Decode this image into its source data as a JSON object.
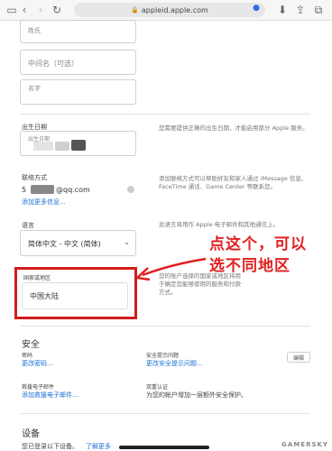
{
  "browser": {
    "url": "appleid.apple.com"
  },
  "form": {
    "last_name_placeholder": "姓氏",
    "middle_name_placeholder": "中间名（可选）",
    "first_name_placeholder": "名字",
    "birthday_label": "出生日期",
    "birthday_placeholder": "出生日期",
    "birthday_desc": "您需要提供正确的出生日期，才能启用部分 Apple 服务。",
    "contact_label": "联络方式",
    "email_prefix": "5",
    "email_suffix": "@qq.com",
    "add_more_link": "添加更多信息...",
    "contact_desc": "添加联络方式可以帮助好友和家人通过 iMessage 信息、FaceTime 通话、Game Center 等联系您。",
    "language_label": "语言",
    "language_value": "简体中文 - 中文 (简体)",
    "language_desc": "此语言将用作 Apple 电子邮件和其他通信上。",
    "region_label": "国家或地区",
    "region_value": "中国大陆",
    "region_desc": "您的账户选择的国家或地区将用于确定您能够使用的服务和付款方式。"
  },
  "annotation": {
    "line1": "点这个，可以",
    "line2": "选不同地区"
  },
  "security": {
    "title": "安全",
    "password_label": "密码",
    "change_password_link": "更改密码...",
    "questions_label": "安全提示问题",
    "change_questions_link": "更改安全提示问题...",
    "edit_button": "编辑",
    "rescue_label": "救援电子邮件",
    "rescue_link": "添加救援电子邮件...",
    "twofactor_label": "双重认证",
    "twofactor_desc": "为您的帐户增加一层额外安全保护。"
  },
  "devices": {
    "title": "设备",
    "desc": "您已登录以下设备。",
    "learn_more_link": "了解更多"
  },
  "watermark": "GAMERSKY",
  "colors": {
    "accent": "#1a6fd6",
    "annotation": "#e22020"
  }
}
